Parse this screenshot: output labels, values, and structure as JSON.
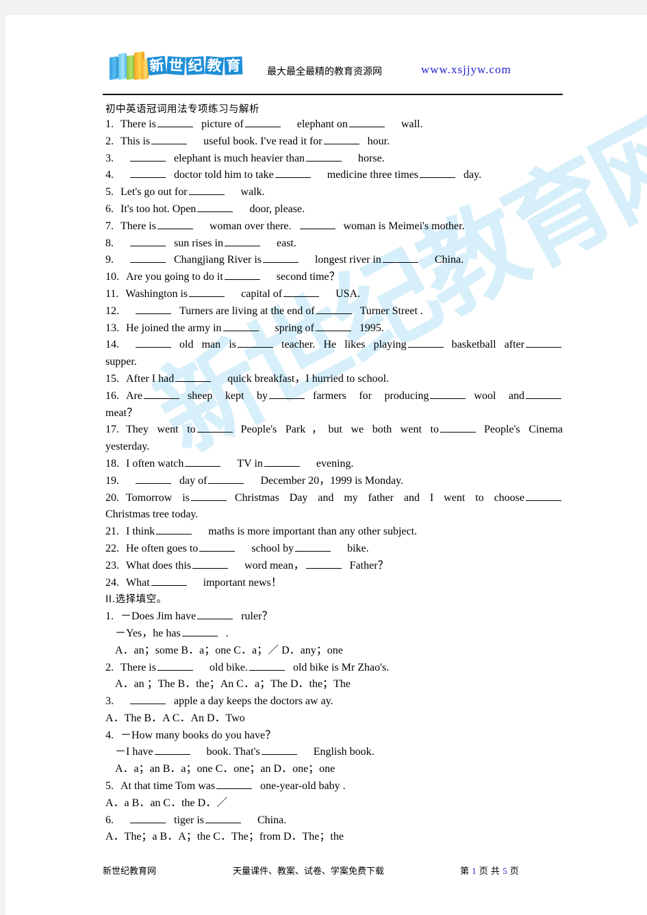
{
  "header": {
    "logo_chars": [
      "新",
      "世",
      "纪",
      "教",
      "育"
    ],
    "slogan": "最大最全最精的教育资源网",
    "url": "www.xsjjyw.com",
    "url_color": "#2222cc"
  },
  "watermark": {
    "text": "新世纪教育网",
    "color": "#d6effa"
  },
  "doc": {
    "title": "初中英语冠词用法专项练习与解析",
    "section2_heading": "II.选择填空。"
  },
  "fill_in_items": [
    {
      "num": "1.",
      "parts": [
        "There is",
        "picture of",
        "elephant on",
        "wall."
      ]
    },
    {
      "num": "2.",
      "parts": [
        "This is",
        "useful book. I've read it for",
        "hour."
      ]
    },
    {
      "num": "3.",
      "parts": [
        "",
        "elephant is much heavier than",
        "horse."
      ]
    },
    {
      "num": "4.",
      "parts": [
        "",
        "doctor told him to take",
        "medicine three times",
        "day."
      ]
    },
    {
      "num": "5.",
      "parts": [
        "Let's go out for",
        "walk."
      ]
    },
    {
      "num": "6.",
      "parts": [
        "It's too hot. Open",
        "door, please."
      ]
    },
    {
      "num": "7.",
      "parts": [
        "There is",
        "woman over there.",
        "woman is Meimei's mother."
      ]
    },
    {
      "num": "8.",
      "parts": [
        "",
        "sun rises in",
        "east."
      ]
    },
    {
      "num": "9.",
      "parts": [
        "",
        "Changjiang River is",
        "longest river in",
        "China."
      ]
    },
    {
      "num": "10.",
      "parts": [
        "Are you going to do it",
        "second time？"
      ]
    },
    {
      "num": "11.",
      "parts": [
        "Washington is",
        "capital of",
        "USA."
      ]
    },
    {
      "num": "12.",
      "parts": [
        "",
        "Turners are living at the end of",
        "Turner Street ."
      ]
    },
    {
      "num": "13.",
      "parts": [
        "He joined the army in",
        "spring of",
        "1995."
      ]
    },
    {
      "num": "14.",
      "parts": [
        "",
        "old man is",
        "teacher. He likes playing",
        "basketball after",
        ""
      ],
      "wrap": "supper."
    },
    {
      "num": "15.",
      "parts": [
        "After I had",
        "quick breakfast，I hurried to school."
      ]
    },
    {
      "num": "16.",
      "parts": [
        "Are",
        "sheep kept by",
        "farmers for producing",
        "wool and",
        ""
      ],
      "wrap": "meat？"
    },
    {
      "num": "17.",
      "parts": [
        "They went to",
        "People's Park，but we both went to",
        "People's Cinema"
      ],
      "wrap": "yesterday."
    },
    {
      "num": "18.",
      "parts": [
        "I often watch",
        "TV in",
        "evening."
      ]
    },
    {
      "num": "19.",
      "parts": [
        "",
        "day of",
        "December 20，1999 is Monday."
      ]
    },
    {
      "num": "20.",
      "parts": [
        "Tomorrow is",
        "Christmas Day and my father and I went to choose",
        ""
      ],
      "wrap": "Christmas tree today."
    },
    {
      "num": "21.",
      "parts": [
        "I think",
        "maths is more important than any other subject."
      ]
    },
    {
      "num": "22.",
      "parts": [
        "He often goes to",
        "school by",
        "bike."
      ]
    },
    {
      "num": "23.",
      "parts": [
        "What does this",
        "word mean，",
        "Father？"
      ]
    },
    {
      "num": "24.",
      "parts": [
        "What",
        "important news！"
      ]
    }
  ],
  "choice_items": [
    {
      "num": "1.",
      "stem": [
        "－Does Jim have",
        "ruler？"
      ],
      "stem2": [
        "－Yes，he has",
        "."
      ],
      "options": "A．an；some    B．a；one    C．a；／    D．any；one"
    },
    {
      "num": "2.",
      "stem": [
        "There is",
        "old bike.",
        "old bike is Mr Zhao's."
      ],
      "options": "A．an ；The    B．the；An   C．a；The    D．the；The"
    },
    {
      "num": "3.",
      "stem": [
        "",
        "apple a day keeps the doctors aw ay."
      ],
      "options": "A．The     B．A     C．An     D．Two"
    },
    {
      "num": "4.",
      "stem": [
        "－How many books do you have？"
      ],
      "stem2": [
        "－I have",
        "book. That's",
        "English book."
      ],
      "options": "A．a；an  B．a；one C．one；an    D．one；one"
    },
    {
      "num": "5.",
      "stem": [
        "At that time Tom was",
        "one-year-old baby ."
      ],
      "options": "A．a       B．an      C．the      D．／"
    },
    {
      "num": "6.",
      "stem": [
        "",
        "tiger is",
        "China."
      ],
      "options": "A．The；a    B．A；the    C．The；from    D．The；the"
    }
  ],
  "footer": {
    "left": "新世纪教育网",
    "center": "天量课件、教案、试卷、学案免费下载",
    "page_prefix": "第",
    "page_num": "1",
    "page_mid": "页 共",
    "page_total": "5",
    "page_suffix": "页"
  }
}
